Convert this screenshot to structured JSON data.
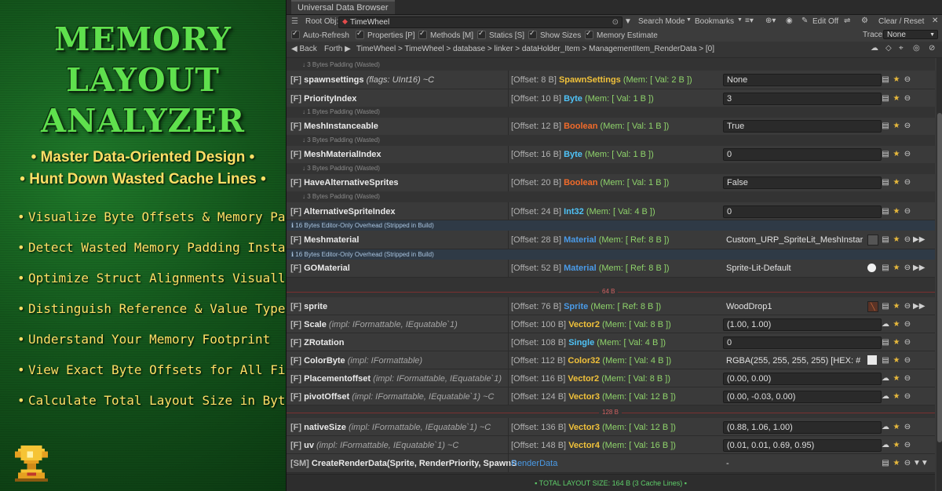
{
  "promo": {
    "title_lines": [
      "MEMORY",
      "LAYOUT",
      "ANALYZER"
    ],
    "subtitles": [
      "• Master Data-Oriented Design •",
      "• Hunt Down Wasted Cache Lines •"
    ],
    "features": [
      "Visualize Byte Offsets & Memory Padding",
      "Detect Wasted Memory Padding Instantly",
      "Optimize Struct Alignments Visually",
      "Distinguish Reference & Value Type Sizes",
      "Understand Your Memory Footprint",
      "View Exact Byte Offsets for All Fields",
      "Calculate Total Layout Size in Bytes"
    ],
    "bullet": "•",
    "trophy_icon": "trophy-icon"
  },
  "window": {
    "title": "Universal Data Browser",
    "root_label": "Root Obj:",
    "root_value": "TimeWheel",
    "search_mode": "Search Mode",
    "bookmarks": "Bookmarks",
    "edit_off": "Edit Off",
    "clear_reset": "Clear / Reset",
    "options": [
      {
        "label": "Auto-Refresh"
      },
      {
        "label": "Properties [P]"
      },
      {
        "label": "Methods [M]"
      },
      {
        "label": "Statics [S]"
      },
      {
        "label": "Show Sizes"
      },
      {
        "label": "Memory Estimate"
      }
    ],
    "trace_label": "Trace:",
    "trace_value": "None",
    "nav": {
      "back": "◀ Back",
      "forth": "Forth ▶",
      "breadcrumb": "TimeWheel  >  TimeWheel  >  database  >  linker  >  dataHolder_Item  >  ManagementItem_RenderData  >  [0]"
    }
  },
  "rows": {
    "pad0": "↓ 3 Bytes Padding (Wasted)",
    "r1": {
      "name": "spawnsettings",
      "flags": "(flags: UInt16) ~C",
      "offset": "[Offset: 8 B]",
      "type": "SpawnSettings",
      "type_color": "#f0c13a",
      "mem": "(Mem: [ Val: 2 B ])",
      "value": "None"
    },
    "r2": {
      "name": "PriorityIndex",
      "offset": "[Offset: 10 B]",
      "type": "Byte",
      "type_color": "#4fc3f7",
      "mem": "(Mem: [ Val: 1 B ])",
      "value": "3"
    },
    "pad2": "↓ 1 Bytes Padding (Wasted)",
    "r3": {
      "name": "MeshInstanceable",
      "offset": "[Offset: 12 B]",
      "type": "Boolean",
      "type_color": "#f26b2a",
      "mem": "(Mem: [ Val: 1 B ])",
      "value": "True"
    },
    "pad3": "↓ 3 Bytes Padding (Wasted)",
    "r4": {
      "name": "MeshMaterialIndex",
      "offset": "[Offset: 16 B]",
      "type": "Byte",
      "type_color": "#4fc3f7",
      "mem": "(Mem: [ Val: 1 B ])",
      "value": "0"
    },
    "pad4": "↓ 3 Bytes Padding (Wasted)",
    "r5": {
      "name": "HaveAlternativeSprites",
      "offset": "[Offset: 20 B]",
      "type": "Boolean",
      "type_color": "#f26b2a",
      "mem": "(Mem: [ Val: 1 B ])",
      "value": "False"
    },
    "pad5": "↓ 3 Bytes Padding (Wasted)",
    "r6": {
      "name": "AlternativeSpriteIndex",
      "offset": "[Offset: 24 B]",
      "type": "Int32",
      "type_color": "#4fc3f7",
      "mem": "(Mem: [ Val: 4 B ])",
      "value": "0"
    },
    "ed6": "ℹ 16 Bytes Editor-Only Overhead (Stripped in Build)",
    "r7": {
      "name": "Meshmaterial",
      "offset": "[Offset: 28 B]",
      "type": "Material",
      "type_color": "#4a9be8",
      "mem": "(Mem: [ Ref: 8 B ])",
      "value": "Custom_URP_SpriteLit_MeshInstar"
    },
    "ed7": "ℹ 16 Bytes Editor-Only Overhead (Stripped in Build)",
    "r8": {
      "name": "GOMaterial",
      "offset": "[Offset: 52 B]",
      "type": "Material",
      "type_color": "#4a9be8",
      "mem": "(Mem: [ Ref: 8 B ])",
      "value": "Sprite-Lit-Default"
    },
    "cache1": "64 B",
    "r9": {
      "name": "sprite",
      "offset": "[Offset: 76 B]",
      "type": "Sprite",
      "type_color": "#4a9be8",
      "mem": "(Mem: [ Ref: 8 B ])",
      "value": "WoodDrop1"
    },
    "r10": {
      "name": "Scale",
      "impl": "(impl: IFormattable, IEquatable`1)",
      "offset": "[Offset: 100 B]",
      "type": "Vector2",
      "type_color": "#f0c13a",
      "mem": "(Mem: [ Val: 8 B ])",
      "value": "(1.00, 1.00)"
    },
    "r11": {
      "name": "ZRotation",
      "offset": "[Offset: 108 B]",
      "type": "Single",
      "type_color": "#4fc3f7",
      "mem": "(Mem: [ Val: 4 B ])",
      "value": "0"
    },
    "r12": {
      "name": "ColorByte",
      "impl": "(impl: IFormattable)",
      "offset": "[Offset: 112 B]",
      "type": "Color32",
      "type_color": "#f0c13a",
      "mem": "(Mem: [ Val: 4 B ])",
      "value": "RGBA(255, 255, 255, 255)  [HEX: #"
    },
    "r13": {
      "name": "Placementoffset",
      "impl": "(impl: IFormattable, IEquatable`1)",
      "offset": "[Offset: 116 B]",
      "type": "Vector2",
      "type_color": "#f0c13a",
      "mem": "(Mem: [ Val: 8 B ])",
      "value": "(0.00, 0.00)"
    },
    "r14": {
      "name": "pivotOffset",
      "impl": "(impl: IFormattable, IEquatable`1) ~C",
      "offset": "[Offset: 124 B]",
      "type": "Vector3",
      "type_color": "#f0c13a",
      "mem": "(Mem: [ Val: 12 B ])",
      "value": "(0.00, -0.03, 0.00)"
    },
    "cache2": "128 B",
    "r15": {
      "name": "nativeSize",
      "impl": "(impl: IFormattable, IEquatable`1) ~C",
      "offset": "[Offset: 136 B]",
      "type": "Vector3",
      "type_color": "#f0c13a",
      "mem": "(Mem: [ Val: 12 B ])",
      "value": "(0.88, 1.06, 1.00)"
    },
    "r16": {
      "name": "uv",
      "impl": "(impl: IFormattable, IEquatable`1) ~C",
      "offset": "[Offset: 148 B]",
      "type": "Vector4",
      "type_color": "#f0c13a",
      "mem": "(Mem: [ Val: 16 B ])",
      "value": "(0.01, 0.01, 0.69, 0.95)"
    },
    "r17": {
      "tag": "[SM]",
      "name": "CreateRenderData(Sprite, RenderPriority, SpawnS",
      "type": "RenderData",
      "type_color": "#4a9be8",
      "value": "-"
    },
    "field_tag": "[F]"
  },
  "total": "▪ TOTAL LAYOUT SIZE: 164 B (3 Cache Lines) ▪"
}
